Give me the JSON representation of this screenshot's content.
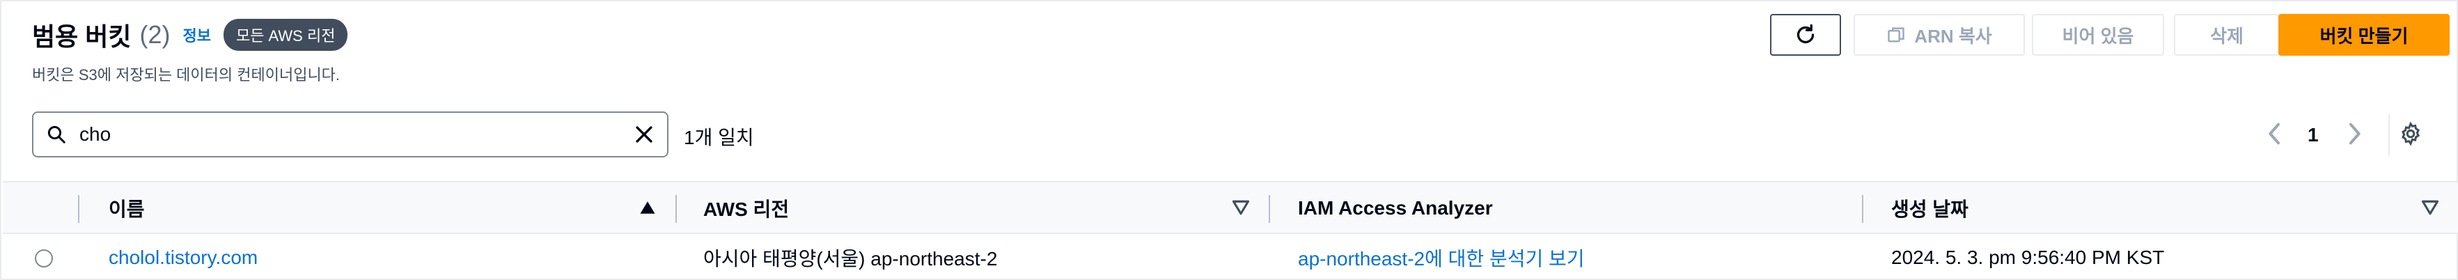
{
  "header": {
    "title": "범용 버킷",
    "count": "(2)",
    "info_link": "정보",
    "region_badge": "모든 AWS 리전",
    "subtitle": "버킷은 S3에 저장되는 데이터의 컨테이너입니다."
  },
  "toolbar": {
    "refresh_icon": "refresh-icon",
    "copy_arn_label": "ARN 복사",
    "copy_icon": "copy-icon",
    "empty_label": "비어 있음",
    "delete_label": "삭제",
    "create_label": "버킷 만들기"
  },
  "search": {
    "value": "cho",
    "icon": "search-icon",
    "clear_icon": "clear-icon",
    "match_count": "1개 일치"
  },
  "pagination": {
    "current_page": "1",
    "prev_icon": "chevron-left-icon",
    "next_icon": "chevron-right-icon",
    "settings_icon": "gear-icon"
  },
  "table": {
    "columns": [
      {
        "label": "이름",
        "sort": "ascending"
      },
      {
        "label": "AWS 리전",
        "sort": "none"
      },
      {
        "label": "IAM Access Analyzer",
        "sort": "none"
      },
      {
        "label": "생성 날짜",
        "sort": "none"
      }
    ],
    "rows": [
      {
        "name": "cholol.tistory.com",
        "region": "아시아 태평양(서울) ap-northeast-2",
        "analyzer_link": "ap-northeast-2에 대한 분석기 보기",
        "created": "2024. 5. 3. pm 9:56:40 PM KST"
      }
    ]
  },
  "colors": {
    "primary": "#ff9900",
    "link": "#0972d3",
    "badge": "#414d5c"
  }
}
